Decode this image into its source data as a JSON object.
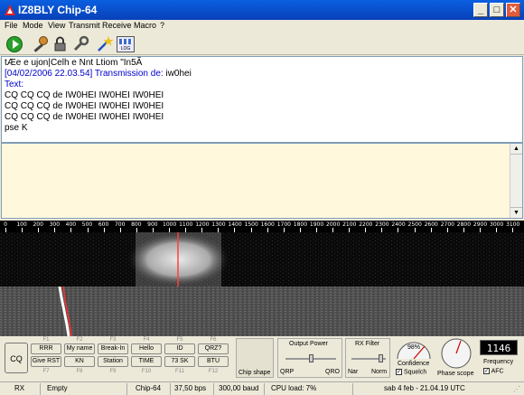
{
  "window": {
    "title": "IZ8BLY Chip-64",
    "min": "_",
    "max": "□",
    "close": "✕"
  },
  "menu": [
    "File",
    "Mode",
    "View",
    "Transmit",
    "Receive",
    "Macro",
    "?"
  ],
  "toolbar": {
    "icons": [
      "play-icon",
      "microphone-icon",
      "lock-icon",
      "wrench-icon",
      "wizard-icon",
      "log-icon"
    ],
    "log_label": "LOG"
  },
  "rx": {
    "lines": [
      "tÆe  e ujon|Celh e Nnt Ltiom \"In5Ã",
      "Text:",
      "CQ CQ CQ de IW0HEI IW0HEI IW0HEI",
      "CQ CQ CQ de IW0HEI IW0HEI IW0HEI",
      "CQ CQ CQ de IW0HEI IW0HEI IW0HEI",
      "pse K"
    ],
    "stamp": "[04/02/2006 22.03.54] Transmission de:",
    "callsign": " iw0hei"
  },
  "ruler": {
    "ticks": [
      "0",
      "100",
      "200",
      "300",
      "400",
      "500",
      "600",
      "700",
      "800",
      "900",
      "1000",
      "1100",
      "1200",
      "1300",
      "1400",
      "1500",
      "1600",
      "1700",
      "1800",
      "1900",
      "2000",
      "2100",
      "2200",
      "2300",
      "2400",
      "2500",
      "2600",
      "2700",
      "2800",
      "2900",
      "3000",
      "3100",
      "32"
    ]
  },
  "macros": {
    "cq": "CQ",
    "row1": [
      {
        "label": "RRR",
        "key": "F1"
      },
      {
        "label": "My name",
        "key": "F2"
      },
      {
        "label": "Break-In",
        "key": "F3"
      },
      {
        "label": "Hello",
        "key": "F4"
      },
      {
        "label": "ID",
        "key": "F5"
      },
      {
        "label": "QRZ?",
        "key": "F6"
      }
    ],
    "row2": [
      {
        "label": "Give RST",
        "key": "F7"
      },
      {
        "label": "KN",
        "key": "F8"
      },
      {
        "label": "Station",
        "key": "F9"
      },
      {
        "label": "TIME",
        "key": "F10"
      },
      {
        "label": "73 SK",
        "key": "F11"
      },
      {
        "label": "BTU",
        "key": "F12"
      }
    ]
  },
  "panels": {
    "chip_shape": "Chip shape",
    "output_power": "Output Power",
    "qrp": "QRP",
    "qro": "QRO",
    "rx_filter": "RX Filter",
    "nar": "Nar",
    "norm": "Norm",
    "confidence_value": "98%",
    "confidence": "Confidence",
    "squelch": "Squelch",
    "phase_scope": "Phase scope",
    "frequency_value": "1146",
    "frequency": "Frequency",
    "afc": "AFC"
  },
  "status": {
    "mode": "RX",
    "buffer": "Empty",
    "codec": "Chip-64",
    "bps": "37,50 bps",
    "baud": "300,00 baud",
    "cpu": "CPU load: 7%",
    "datetime": "sab 4 feb - 21.04.19 UTC"
  },
  "colors": {
    "title_bar": "#0a5fe0",
    "accent_blue": "#0000cc",
    "marker": "#ff4040"
  }
}
